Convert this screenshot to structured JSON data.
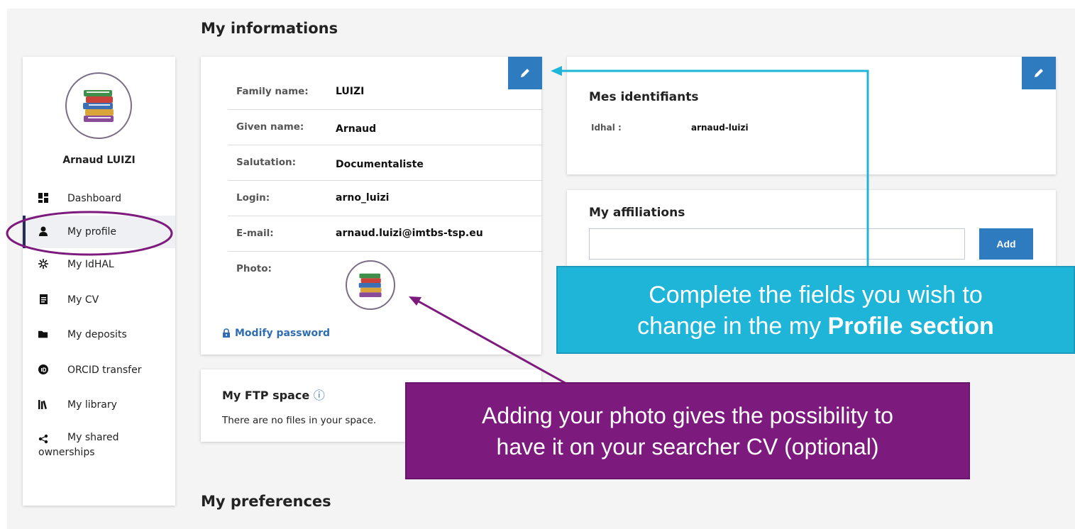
{
  "page": {
    "title": "My informations",
    "preferences_title": "My preferences"
  },
  "sidebar": {
    "user_name": "Arnaud LUIZI",
    "items": [
      {
        "label": "Dashboard",
        "icon": "dashboard-icon"
      },
      {
        "label": "My profile",
        "icon": "user-icon",
        "active": true
      },
      {
        "label": "My IdHAL",
        "icon": "idhal-icon"
      },
      {
        "label": "My CV",
        "icon": "cv-icon"
      },
      {
        "label": "My deposits",
        "icon": "folder-icon"
      },
      {
        "label": "ORCID transfer",
        "icon": "orcid-icon"
      },
      {
        "label": "My library",
        "icon": "library-icon"
      },
      {
        "label": "My shared",
        "label2": "ownerships",
        "icon": "share-icon"
      }
    ]
  },
  "info": {
    "rows": [
      {
        "label": "Family name:",
        "value": "LUIZI"
      },
      {
        "label": "Given name:",
        "value": "Arnaud"
      },
      {
        "label": "Salutation:",
        "value": "Documentaliste"
      },
      {
        "label": "Login:",
        "value": "arno_luizi"
      },
      {
        "label": "E-mail:",
        "value": "arnaud.luizi@imtbs-tsp.eu"
      }
    ],
    "photo_label": "Photo:",
    "modify_password": "Modify password"
  },
  "identifiants": {
    "title": "Mes identifiants",
    "idhal_label": "Idhal :",
    "idhal_value": "arnaud-luizi"
  },
  "affiliations": {
    "title": "My affiliations",
    "input_value": "",
    "add_label": "Add"
  },
  "ftp": {
    "title": "My FTP space",
    "info_icon": "ⓘ",
    "empty_text": "There are no files in your space."
  },
  "callouts": {
    "blue_line1": "Complete the fields you wish to",
    "blue_line2_pre": "change in the my ",
    "blue_line2_bold": "Profile section",
    "purple_line1": "Adding your photo gives the possibility to",
    "purple_line2": "have it on your searcher CV (optional)"
  },
  "colors": {
    "accent": "#2f7bbf",
    "callout_blue": "#1fb5d8",
    "callout_purple": "#7d1a7d",
    "nav_active": "#252d55"
  }
}
